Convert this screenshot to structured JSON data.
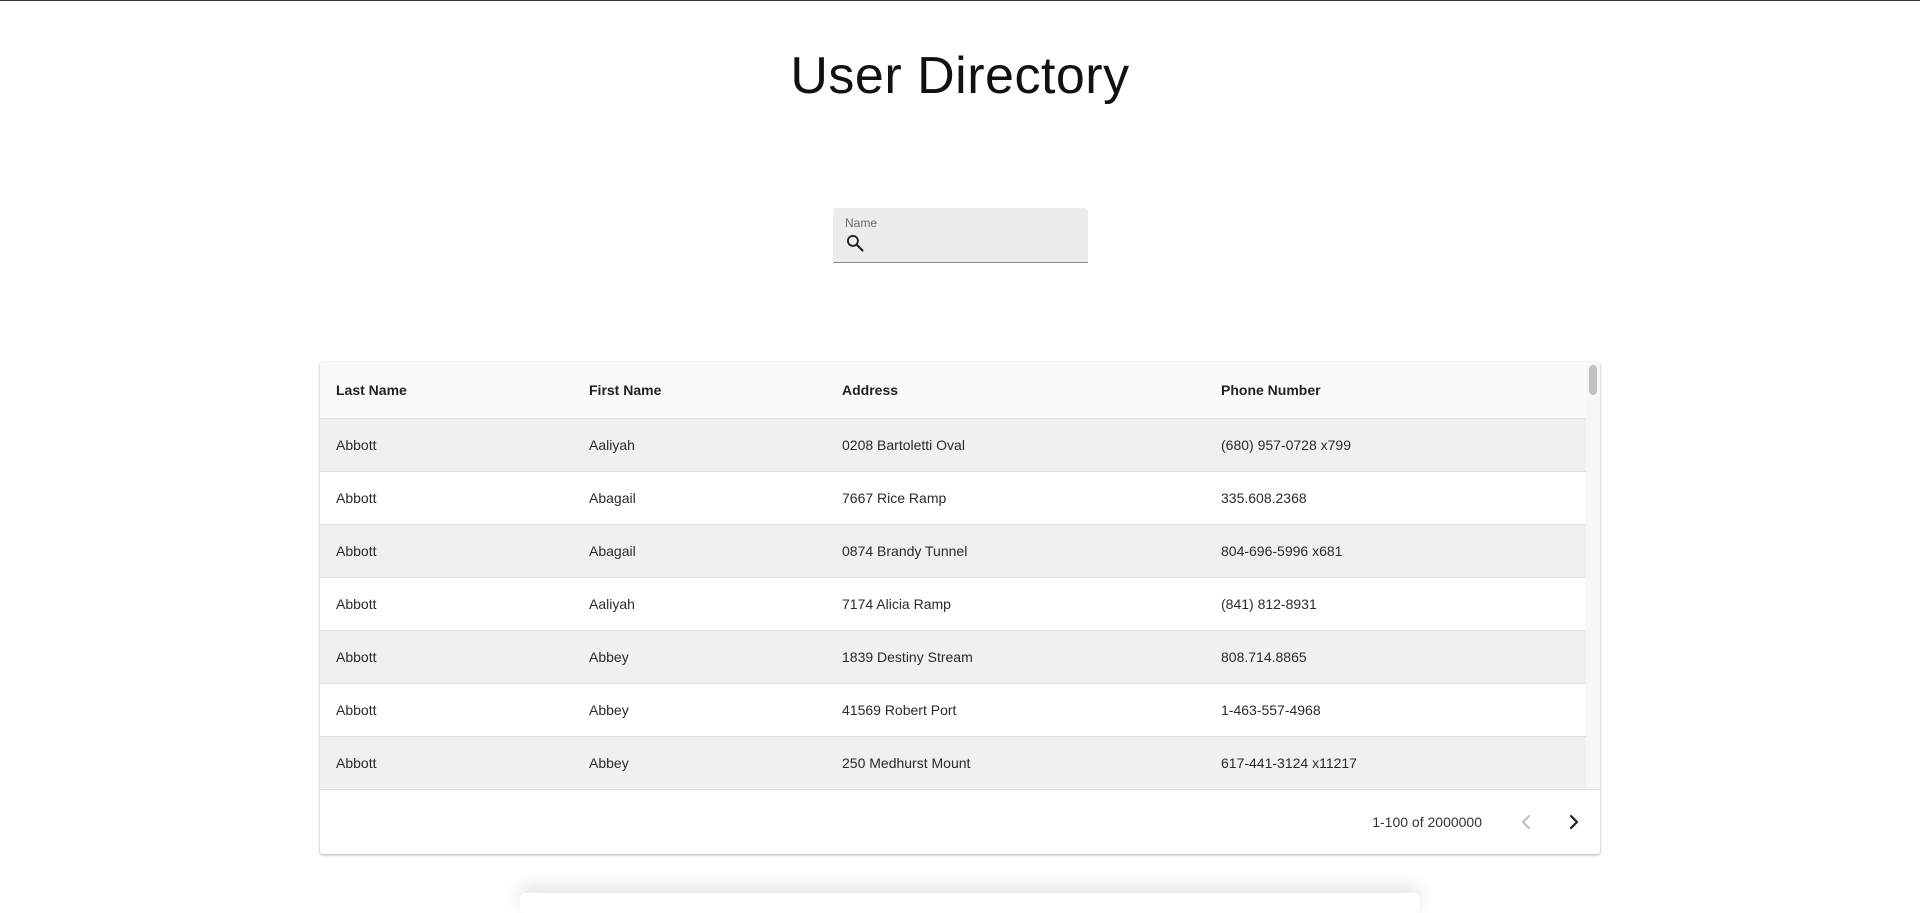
{
  "header": {
    "title": "User Directory"
  },
  "search": {
    "label": "Name",
    "value": "",
    "icon": "search-icon"
  },
  "table": {
    "columns": [
      "Last Name",
      "First Name",
      "Address",
      "Phone Number"
    ],
    "rows": [
      [
        "Abbott",
        "Aaliyah",
        "0208 Bartoletti Oval",
        "(680) 957-0728 x799"
      ],
      [
        "Abbott",
        "Abagail",
        "7667 Rice Ramp",
        "335.608.2368"
      ],
      [
        "Abbott",
        "Abagail",
        "0874 Brandy Tunnel",
        "804-696-5996 x681"
      ],
      [
        "Abbott",
        "Aaliyah",
        "7174 Alicia Ramp",
        "(841) 812-8931"
      ],
      [
        "Abbott",
        "Abbey",
        "1839 Destiny Stream",
        "808.714.8865"
      ],
      [
        "Abbott",
        "Abbey",
        "41569 Robert Port",
        "1-463-557-4968"
      ],
      [
        "Abbott",
        "Abbey",
        "250 Medhurst Mount",
        "617-441-3124 x11217"
      ]
    ]
  },
  "pagination": {
    "range_text": "1-100 of 2000000",
    "prev_icon": "chevron-left-icon",
    "next_icon": "chevron-right-icon",
    "prev_enabled": false,
    "next_enabled": true
  },
  "colors": {
    "row_striped": "#f0f0f0",
    "row_plain": "#ffffff",
    "header_bg": "#fafafa",
    "search_bg": "#ececec",
    "disabled_icon": "#bdbdbd",
    "enabled_icon": "#222222"
  }
}
